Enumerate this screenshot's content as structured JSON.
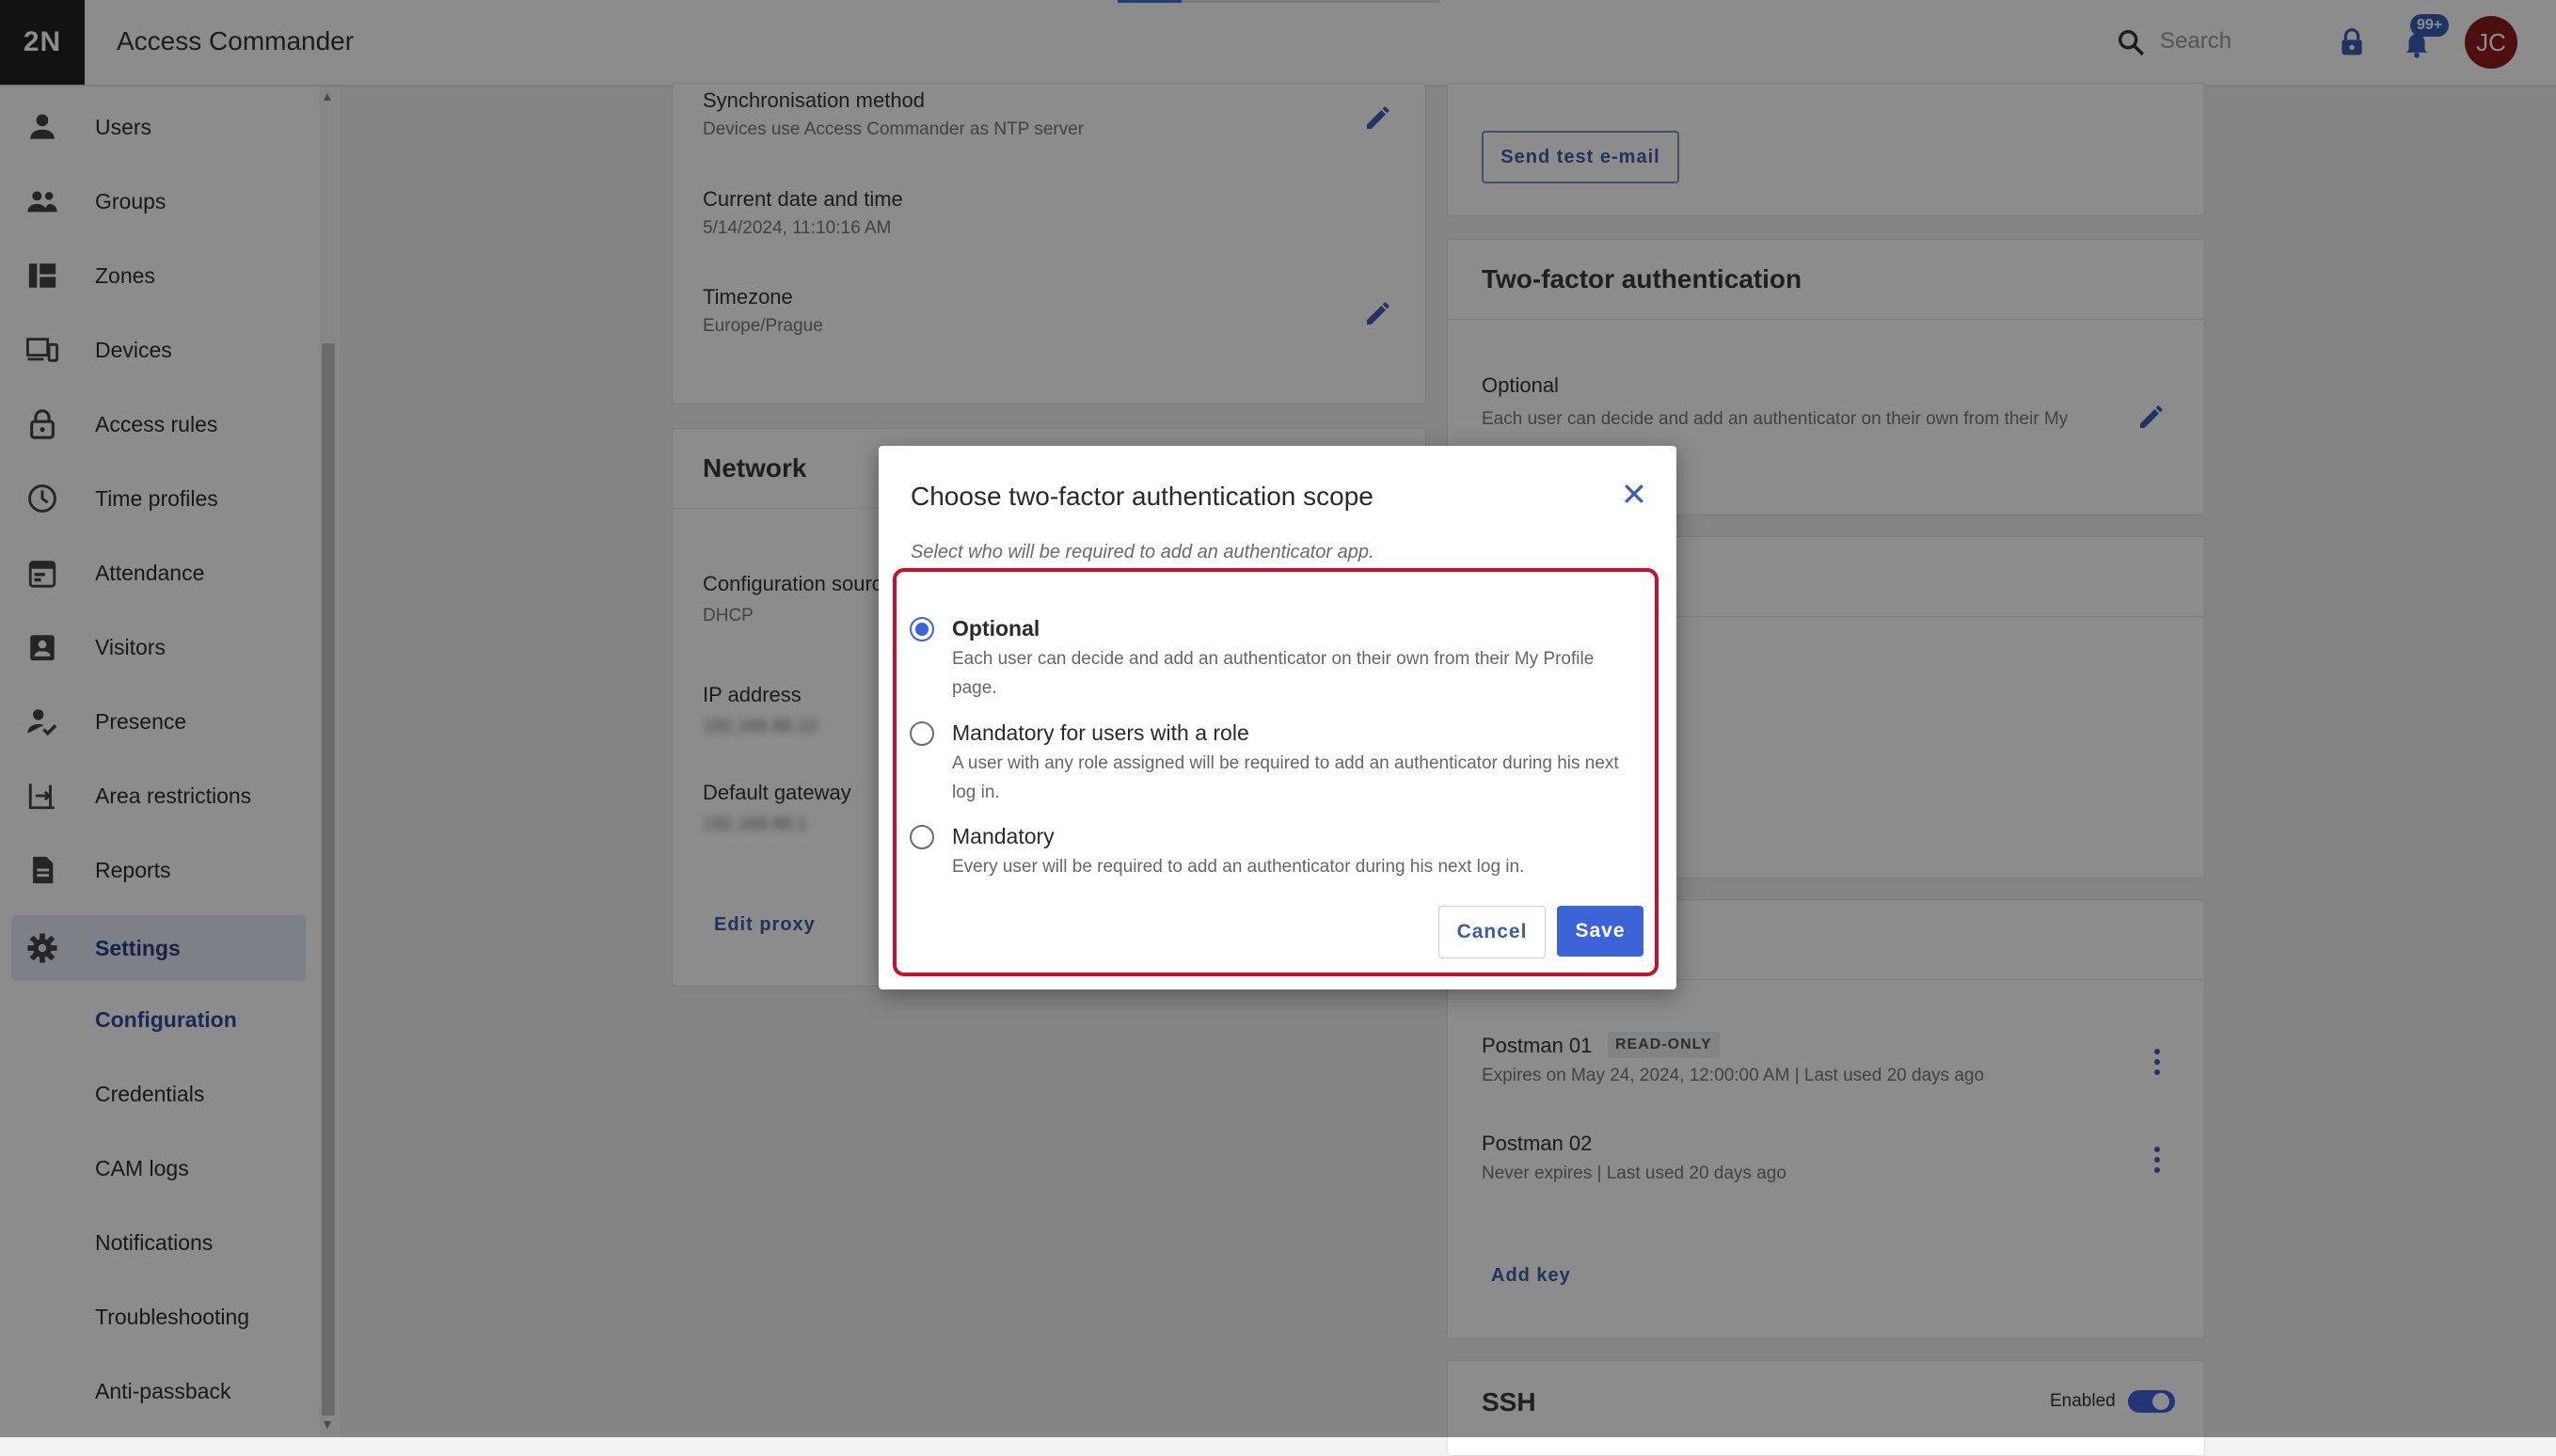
{
  "app": {
    "logo": "2N",
    "title": "Access Commander"
  },
  "header": {
    "search_placeholder": "Search",
    "notification_count": "99+",
    "avatar_initials": "JC"
  },
  "sidebar": {
    "items": [
      {
        "label": "Users",
        "icon": "user-icon"
      },
      {
        "label": "Groups",
        "icon": "groups-icon"
      },
      {
        "label": "Zones",
        "icon": "zones-icon"
      },
      {
        "label": "Devices",
        "icon": "devices-icon"
      },
      {
        "label": "Access rules",
        "icon": "lock-icon"
      },
      {
        "label": "Time profiles",
        "icon": "clock-icon"
      },
      {
        "label": "Attendance",
        "icon": "calendar-icon"
      },
      {
        "label": "Visitors",
        "icon": "visitor-badge-icon"
      },
      {
        "label": "Presence",
        "icon": "presence-icon"
      },
      {
        "label": "Area restrictions",
        "icon": "area-icon"
      },
      {
        "label": "Reports",
        "icon": "report-icon"
      },
      {
        "label": "Settings",
        "icon": "gear-icon"
      }
    ],
    "subitems": [
      "Configuration",
      "Credentials",
      "CAM logs",
      "Notifications",
      "Troubleshooting",
      "Anti-passback"
    ]
  },
  "time_card": {
    "sync_label": "Synchronisation method",
    "sync_value": "Devices use Access Commander as NTP server",
    "date_label": "Current date and time",
    "date_value": "5/14/2024, 11:10:16 AM",
    "tz_label": "Timezone",
    "tz_value": "Europe/Prague"
  },
  "network_card": {
    "title": "Network",
    "config_label": "Configuration source",
    "config_value": "DHCP",
    "ip_label": "IP address",
    "ip_value": "192.168.88.10",
    "gw_label": "Default gateway",
    "gw_value": "192.168.88.1",
    "edit_proxy": "Edit proxy"
  },
  "email_card": {
    "send_test": "Send test e-mail"
  },
  "twofa_card": {
    "title": "Two-factor authentication",
    "value_label": "Optional",
    "value_desc": "Each user can decide and add an authenticator on their own from their My Profile page."
  },
  "api_keys": {
    "keys": [
      {
        "name": "Postman 01",
        "chip": "READ-ONLY",
        "meta": "Expires on May 24, 2024, 12:00:00 AM | Last used 20 days ago"
      },
      {
        "name": "Postman 02",
        "chip": "",
        "meta": "Never expires | Last used 20 days ago"
      }
    ],
    "add_key": "Add key"
  },
  "ssh_card": {
    "title": "SSH",
    "status": "Enabled"
  },
  "dialog": {
    "title": "Choose two-factor authentication scope",
    "subtitle": "Select who will be required to add an authenticator app.",
    "options": [
      {
        "title": "Optional",
        "desc": "Each user can decide and add an authenticator on their own from their My Profile page.",
        "selected": true
      },
      {
        "title": "Mandatory for users with a role",
        "desc": "A user with any role assigned will be required to add an authenticator during his next log in.",
        "selected": false
      },
      {
        "title": "Mandatory",
        "desc": "Every user will be required to add an authenticator during his next log in.",
        "selected": false
      }
    ],
    "cancel": "Cancel",
    "save": "Save"
  },
  "colors": {
    "accent": "#3d63d8",
    "highlight": "#c8102e",
    "avatar": "#8c1b1b"
  }
}
